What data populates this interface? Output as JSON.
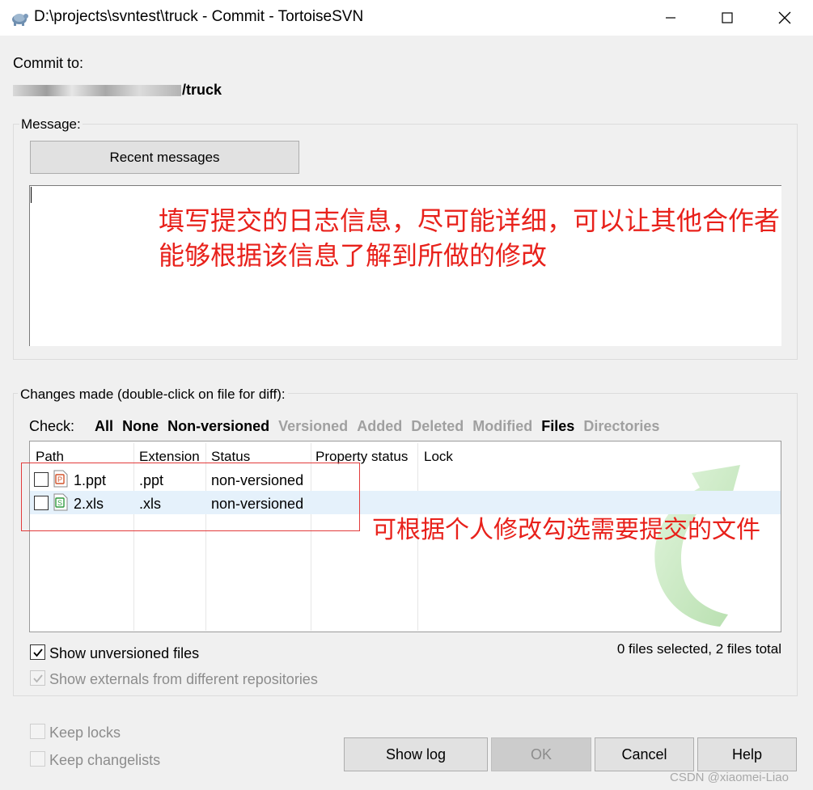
{
  "window": {
    "title": "D:\\projects\\svntest\\truck - Commit - TortoiseSVN",
    "minimize_glyph": "—",
    "maximize_glyph": "☐",
    "close_glyph": "✕"
  },
  "commit": {
    "label": "Commit to:",
    "url_suffix": "/truck"
  },
  "message": {
    "group_label": "Message:",
    "recent_button": "Recent messages",
    "annotation_line1": "填写提交的日志信息，尽可能详细，可以让其他合作者",
    "annotation_line2": "能够根据该信息了解到所做的修改"
  },
  "changes": {
    "group_label": "Changes made (double-click on file for diff):",
    "check_label": "Check:",
    "check_filters": [
      {
        "label": "All",
        "enabled": true
      },
      {
        "label": "None",
        "enabled": true
      },
      {
        "label": "Non-versioned",
        "enabled": true
      },
      {
        "label": "Versioned",
        "enabled": false
      },
      {
        "label": "Added",
        "enabled": false
      },
      {
        "label": "Deleted",
        "enabled": false
      },
      {
        "label": "Modified",
        "enabled": false
      },
      {
        "label": "Files",
        "enabled": true
      },
      {
        "label": "Directories",
        "enabled": false
      }
    ],
    "columns": [
      "Path",
      "Extension",
      "Status",
      "Property status",
      "Lock"
    ],
    "rows": [
      {
        "path": "1.ppt",
        "extension": ".ppt",
        "status": "non-versioned",
        "icon": "powerpoint-file-icon",
        "checked": false
      },
      {
        "path": "2.xls",
        "extension": ".xls",
        "status": "non-versioned",
        "icon": "spreadsheet-file-icon",
        "checked": false
      }
    ],
    "annotation": "可根据个人修改勾选需要提交的文件",
    "show_unversioned_label": "Show unversioned files",
    "show_unversioned_checked": true,
    "show_externals_label": "Show externals from different repositories",
    "show_externals_checked": true,
    "files_count": "0 files selected, 2 files total"
  },
  "bottom": {
    "keep_locks_label": "Keep locks",
    "keep_changelists_label": "Keep changelists",
    "show_log": "Show log",
    "ok": "OK",
    "cancel": "Cancel",
    "help": "Help"
  },
  "watermark": "CSDN @xiaomei-Liao",
  "colors": {
    "annotation": "#e8211b",
    "selected_row": "#e5f1fb",
    "disabled_text": "#a0a0a0"
  }
}
